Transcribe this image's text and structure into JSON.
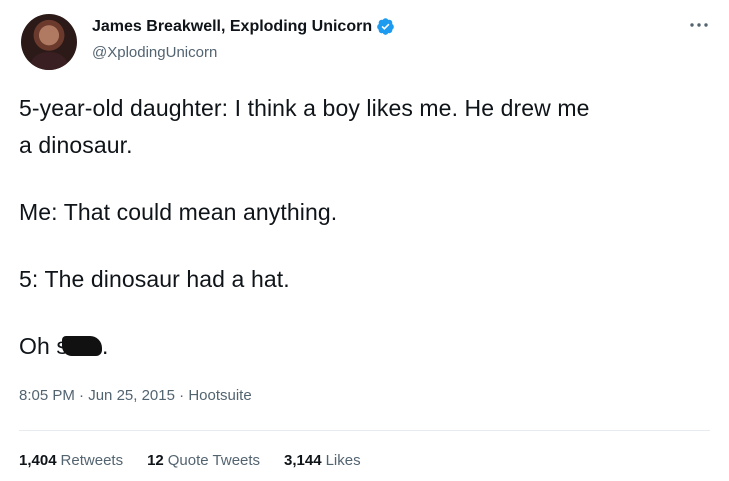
{
  "author": {
    "display_name": "James Breakwell, Exploding Unicorn",
    "handle": "@XplodingUnicorn",
    "avatar_icon": "avatar-photo",
    "verified_icon": "verified-badge-icon",
    "verified_color": "#1d9bf0"
  },
  "tweet": {
    "lines": [
      "5-year-old daughter: I think a boy likes me. He drew me",
      "a dinosaur.",
      "Me: That could mean anything.",
      "5: The dinosaur had a hat.",
      "Oh s"
    ],
    "last_line_end": ".",
    "time": "8:05 PM",
    "separator": "·",
    "date": "Jun 25, 2015",
    "source": "Hootsuite"
  },
  "stats": {
    "retweets_count": "1,404",
    "retweets_label": "Retweets",
    "quotes_count": "12",
    "quotes_label": "Quote Tweets",
    "likes_count": "3,144",
    "likes_label": "Likes"
  },
  "colors": {
    "text": "#0f1419",
    "secondary": "#536471",
    "divider": "#e6ecf0"
  }
}
